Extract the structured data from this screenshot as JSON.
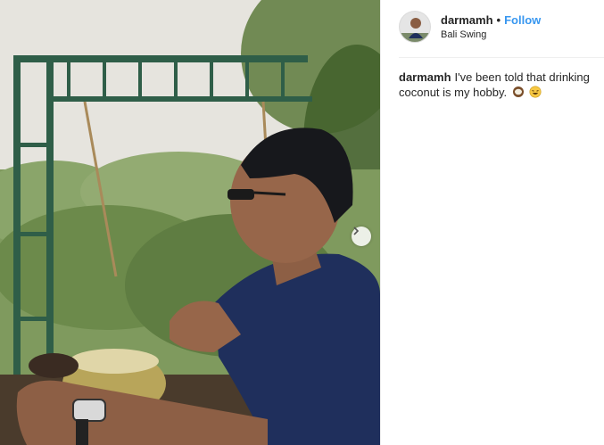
{
  "post": {
    "username": "darmamh",
    "separator": "•",
    "follow_label": "Follow",
    "location": "Bali Swing",
    "caption_text": "I've been told that drinking coconut is my hobby.",
    "emojis": [
      "coconut-emoji",
      "laughing-emoji"
    ],
    "photo_description_icon": "photo",
    "next_icon": "chevron-right-icon"
  },
  "colors": {
    "follow": "#3897f0",
    "text": "#262626",
    "divider": "#efefef"
  }
}
